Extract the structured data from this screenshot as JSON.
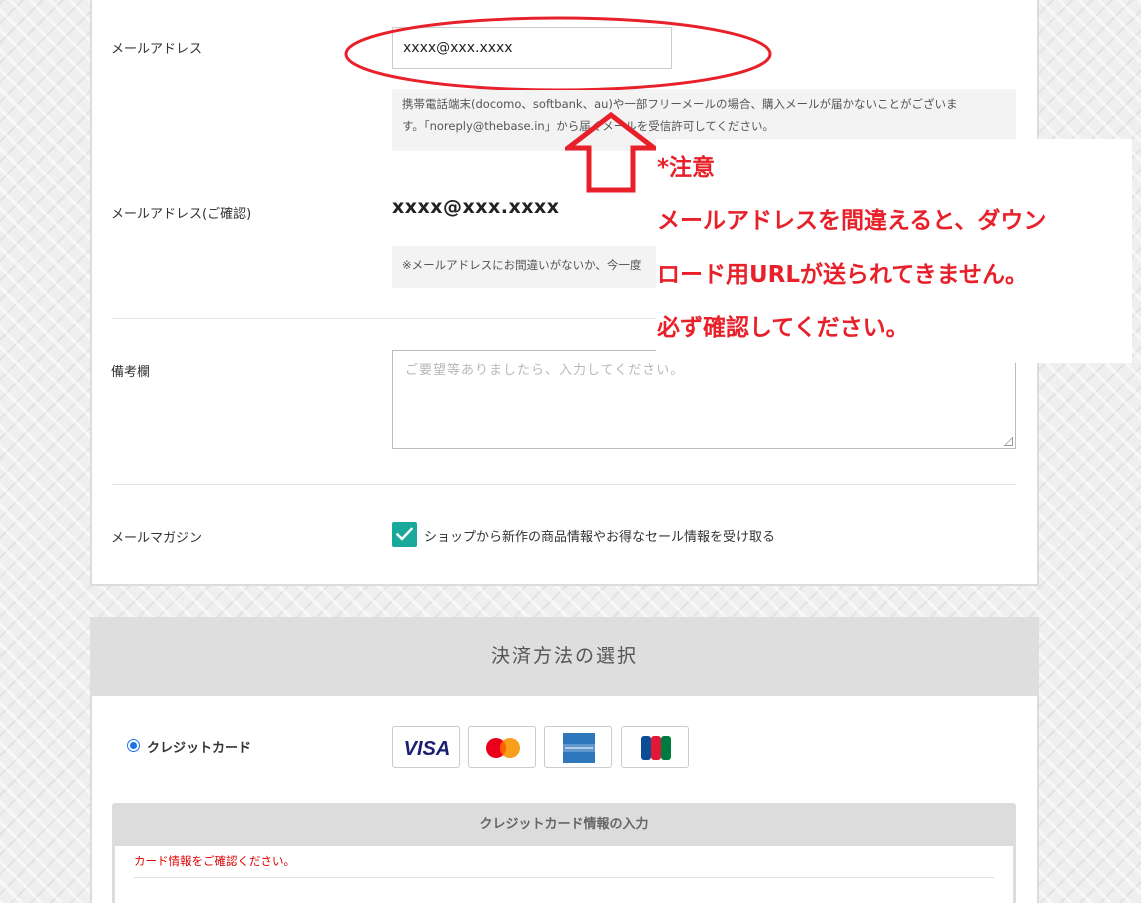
{
  "contact_form": {
    "email_label": "メールアドレス",
    "email_value": "xxxx@xxx.xxxx",
    "email_note_line1": "携帯電話端末(docomo、softbank、au)や一部フリーメールの場合、購入メールが届かないことがございま",
    "email_note_line2": "す。「noreply@thebase.in」から届くメールを受信許可してください。",
    "email_confirm_label": "メールアドレス(ご確認)",
    "email_confirm_value": "xxxx@xxx.xxxx",
    "email_confirm_note": "※メールアドレスにお間違いがないか、今一度",
    "remarks_label": "備考欄",
    "remarks_placeholder": "ご要望等ありましたら、入力してください。",
    "newsletter_label": "メールマガジン",
    "newsletter_checkbox_label": "ショップから新作の商品情報やお得なセール情報を受け取る",
    "newsletter_checked": true
  },
  "payment": {
    "section_title": "決済方法の選択",
    "method_label": "クレジットカード",
    "method_selected": true,
    "brands": [
      "visa-logo",
      "mastercard-logo",
      "amex-logo",
      "jcb-logo"
    ],
    "card_panel_title": "クレジットカード情報の入力",
    "card_error": "カード情報をご確認ください。"
  },
  "annotation": {
    "color": "#e8202a",
    "title": "*注意",
    "line1": "メールアドレスを間違えると、ダウン",
    "line2": "ロード用URLが送られてきません。",
    "line3": "必ず確認してください。"
  },
  "colors": {
    "accent_teal": "#1aa89a",
    "radio_blue": "#1a73e8",
    "error_red": "#dd0000"
  }
}
